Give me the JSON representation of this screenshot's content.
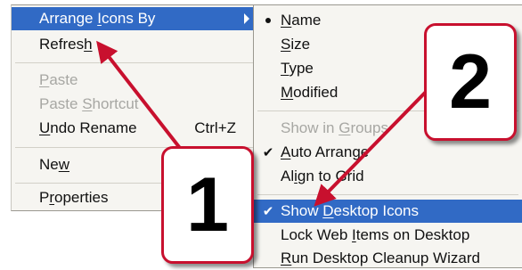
{
  "context_menu": {
    "arrange_icons_by": {
      "label_pre": "Arrange ",
      "label_u": "I",
      "label_post": "cons By"
    },
    "refresh": {
      "label_pre": "Refres",
      "label_u": "h",
      "label_post": ""
    },
    "paste": {
      "label_pre": "",
      "label_u": "P",
      "label_post": "aste"
    },
    "paste_shortcut": {
      "label_pre": "Paste ",
      "label_u": "S",
      "label_post": "hortcut"
    },
    "undo_rename": {
      "label_pre": "",
      "label_u": "U",
      "label_post": "ndo Rename",
      "shortcut": "Ctrl+Z"
    },
    "new": {
      "label_pre": "Ne",
      "label_u": "w",
      "label_post": ""
    },
    "properties": {
      "label_pre": "P",
      "label_u": "r",
      "label_post": "operties"
    }
  },
  "submenu": {
    "name": {
      "label_pre": "",
      "label_u": "N",
      "label_post": "ame",
      "marked": true
    },
    "size": {
      "label_pre": "",
      "label_u": "S",
      "label_post": "ize"
    },
    "type": {
      "label_pre": "",
      "label_u": "T",
      "label_post": "ype"
    },
    "modified": {
      "label_pre": "",
      "label_u": "M",
      "label_post": "odified"
    },
    "show_in_groups": {
      "label_pre": "Show in ",
      "label_u": "G",
      "label_post": "roups"
    },
    "auto_arrange": {
      "label_pre": "",
      "label_u": "A",
      "label_post": "uto Arrange",
      "checked": true
    },
    "align_to_grid": {
      "label_pre": "Al",
      "label_u": "i",
      "label_post": "gn to Grid"
    },
    "show_desktop_icons": {
      "label_pre": "Show ",
      "label_u": "D",
      "label_post": "esktop Icons",
      "checked": true
    },
    "lock_web_items": {
      "label_pre": "Lock Web ",
      "label_u": "I",
      "label_post": "tems on Desktop"
    },
    "run_cleanup": {
      "label_pre": "",
      "label_u": "R",
      "label_post": "un Desktop Cleanup Wizard"
    }
  },
  "annotations": {
    "step_1": "1",
    "step_2": "2",
    "color": "#c8102e"
  },
  "icons": {
    "check": "✔",
    "submenu_arrow": "triangle-right",
    "radio_bullet": "filled-circle"
  }
}
